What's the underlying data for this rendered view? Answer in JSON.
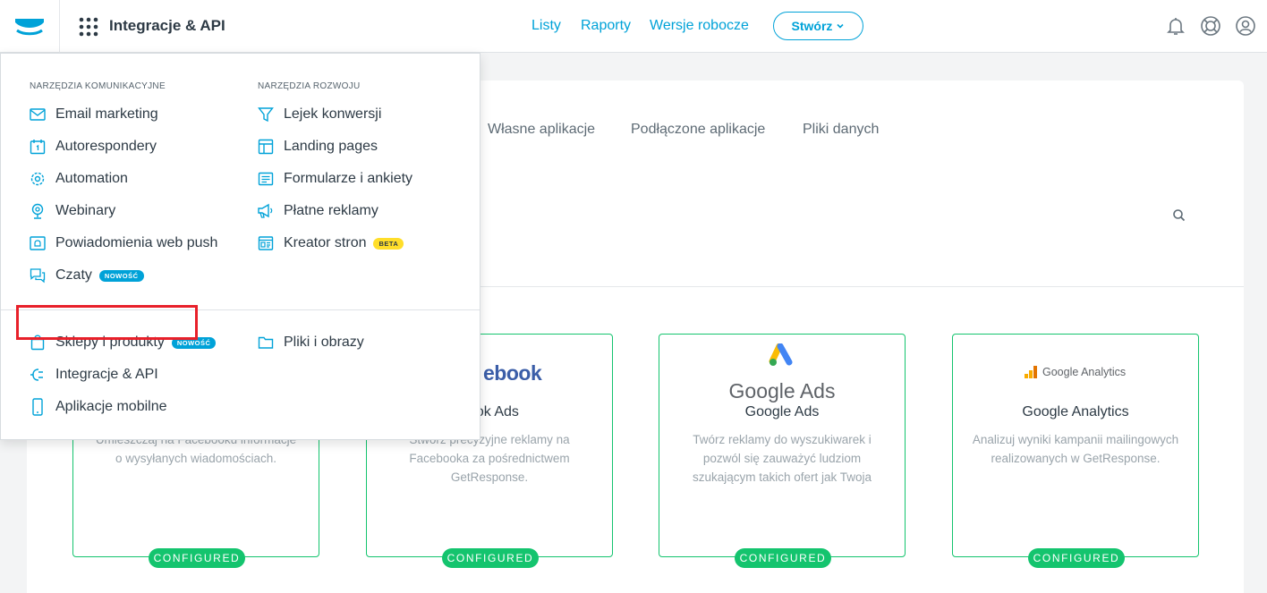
{
  "header": {
    "title": "Integracje & API",
    "nav": [
      "Listy",
      "Raporty",
      "Wersje robocze"
    ],
    "create_label": "Stwórz"
  },
  "menu": {
    "section_communication": "NARZĘDZIA KOMUNIKACYJNE",
    "section_development": "NARZĘDZIA ROZWOJU",
    "left_items": [
      {
        "label": "Email marketing",
        "icon": "envelope-icon"
      },
      {
        "label": "Autorespondery",
        "icon": "calendar-icon"
      },
      {
        "label": "Automation",
        "icon": "automation-gear-icon"
      },
      {
        "label": "Webinary",
        "icon": "webinar-icon"
      },
      {
        "label": "Powiadomienia web push",
        "icon": "bell-window-icon"
      },
      {
        "label": "Czaty",
        "icon": "chat-icon",
        "tag": "NOWOŚĆ"
      }
    ],
    "right_items": [
      {
        "label": "Lejek konwersji",
        "icon": "funnel-icon"
      },
      {
        "label": "Landing pages",
        "icon": "layout-icon"
      },
      {
        "label": "Formularze i ankiety",
        "icon": "form-icon"
      },
      {
        "label": "Płatne reklamy",
        "icon": "megaphone-icon"
      },
      {
        "label": "Kreator stron",
        "icon": "website-icon",
        "tag": "BETA"
      }
    ],
    "bottom_left": [
      {
        "label": "Sklepy i produkty",
        "icon": "shopping-bag-icon",
        "tag": "NOWOŚĆ"
      },
      {
        "label": "Integracje & API",
        "icon": "plug-icon"
      },
      {
        "label": "Aplikacje mobilne",
        "icon": "mobile-icon"
      }
    ],
    "bottom_right": [
      {
        "label": "Pliki i obrazy",
        "icon": "folder-icon"
      }
    ]
  },
  "tabs": [
    "Własne aplikacje",
    "Podłączone aplikacje",
    "Pliki danych"
  ],
  "cards": [
    {
      "title": "",
      "desc": "Umieszczaj na Facebooku informacje o wysyłanych wiadomościach.",
      "badge": "CONFIGURED"
    },
    {
      "title": "book Ads",
      "logo_text": "ebook",
      "desc": "Stwórz precyzyjne reklamy na Facebooka za pośrednictwem GetResponse.",
      "badge": "CONFIGURED"
    },
    {
      "title": "Google Ads",
      "logo_text": "Google Ads",
      "desc": "Twórz reklamy do wyszukiwarek i pozwól się zauważyć ludziom szukającym takich ofert jak Twoja",
      "badge": "CONFIGURED"
    },
    {
      "title": "Google Analytics",
      "logo_text": "Google Analytics",
      "desc": "Analizuj wyniki kampanii mailingowych realizowanych w GetResponse.",
      "badge": "CONFIGURED"
    }
  ],
  "colors": {
    "accent": "#00a2d8",
    "configured": "#14c46e",
    "highlight": "#e8202a",
    "beta": "#ffde2a"
  }
}
